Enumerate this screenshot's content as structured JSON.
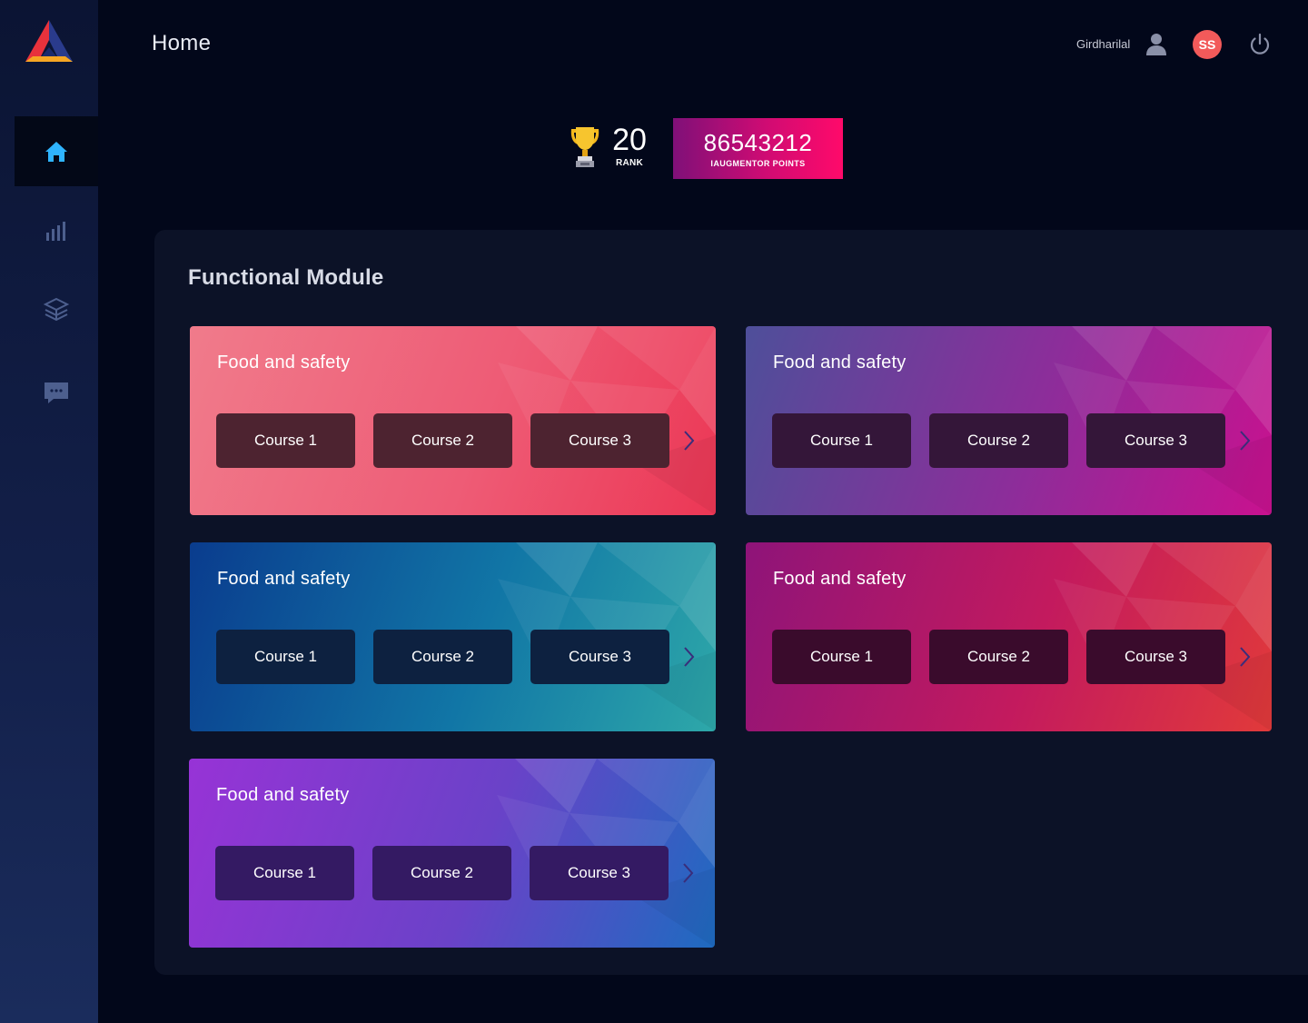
{
  "app": {
    "brand_colors": [
      "#e8323c",
      "#f6a623",
      "#2a3b8c"
    ]
  },
  "sidebar": {
    "items": [
      {
        "name": "home",
        "icon": "home-icon",
        "active": true,
        "color": "#2fb4ff"
      },
      {
        "name": "analytics",
        "icon": "bar-chart-icon",
        "active": false
      },
      {
        "name": "modules",
        "icon": "layers-box-icon",
        "active": false
      },
      {
        "name": "messages",
        "icon": "chat-icon",
        "active": false
      }
    ]
  },
  "header": {
    "title": "Home",
    "user_name": "Girdharilal",
    "avatar_initials": "SS",
    "avatar_color": "#f25a5a"
  },
  "stats": {
    "rank_value": "20",
    "rank_label": "RANK",
    "points_value": "86543212",
    "points_label": "IAUGMENTOR POINTS"
  },
  "module": {
    "title": "Functional Module",
    "cards": [
      {
        "title": "Food and safety",
        "courses": [
          "Course 1",
          "Course 2",
          "Course 3"
        ],
        "theme": "coral-red"
      },
      {
        "title": "Food and safety",
        "courses": [
          "Course 1",
          "Course 2",
          "Course 3"
        ],
        "theme": "indigo-magenta"
      },
      {
        "title": "Food and safety",
        "courses": [
          "Course 1",
          "Course 2",
          "Course 3"
        ],
        "theme": "blue-teal"
      },
      {
        "title": "Food and safety",
        "courses": [
          "Course 1",
          "Course 2",
          "Course 3"
        ],
        "theme": "magenta-red"
      },
      {
        "title": "Food and safety",
        "courses": [
          "Course 1",
          "Course 2",
          "Course 3"
        ],
        "theme": "violet-blue"
      }
    ]
  }
}
